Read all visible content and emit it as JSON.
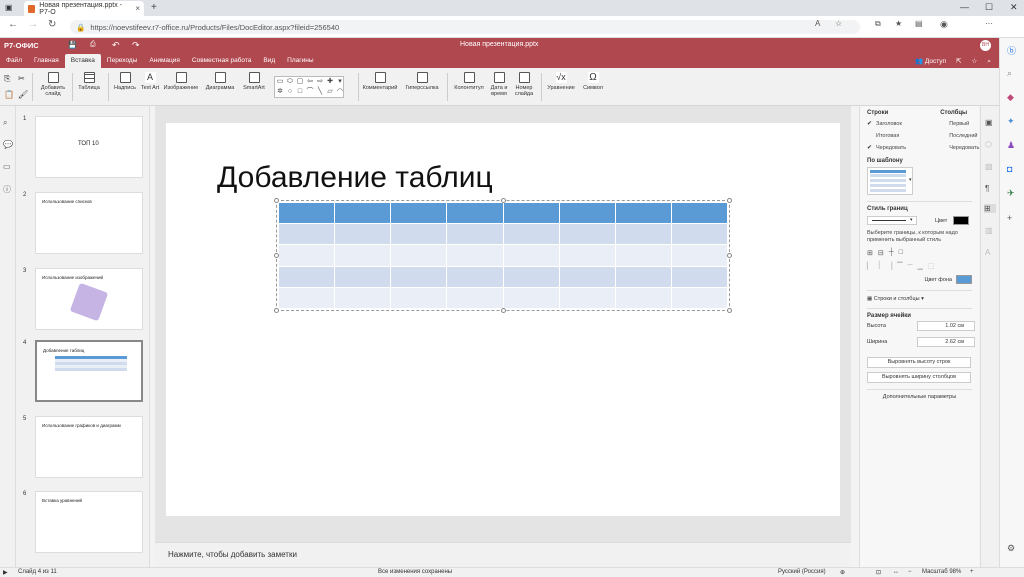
{
  "browser": {
    "tab_title": "Новая презентация.pptx - Р7-О",
    "url": "https://noevstifeev.r7-office.ru/Products/Files/DocEditor.aspx?fileid=256540"
  },
  "app": {
    "brand": "Р7-ОФИС",
    "doc_title": "Новая презентация.pptx",
    "access_label": "Доступ",
    "avatar": "ВН"
  },
  "menu": [
    "Файл",
    "Главная",
    "Вставка",
    "Переходы",
    "Анимация",
    "Совместная работа",
    "Вид",
    "Плагины"
  ],
  "toolbar": {
    "add_slide": "Добавить слайд",
    "table": "Таблица",
    "caption": "Надпись",
    "text_art": "Text Art",
    "image": "Изображение",
    "chart": "Диаграмма",
    "smartart": "SmartArt",
    "comment": "Комментарий",
    "hyperlink": "Гиперссылка",
    "header_footer": "Колонтитул",
    "datetime": "Дата и время",
    "slide_number": "Номер слайда",
    "equation": "Уравнение",
    "symbol": "Символ"
  },
  "thumbnails": [
    {
      "num": "1",
      "text": "ТОП 10"
    },
    {
      "num": "2",
      "text": "Использование списков"
    },
    {
      "num": "3",
      "text": "Использование изображений"
    },
    {
      "num": "4",
      "text": "Добавление таблиц"
    },
    {
      "num": "5",
      "text": "Использование графиков и диаграмм"
    },
    {
      "num": "6",
      "text": "Вставка уравнений"
    }
  ],
  "slide": {
    "title": "Добавление таблиц"
  },
  "notes_placeholder": "Нажмите, чтобы добавить заметки",
  "panel": {
    "rows_heading": "Строки",
    "cols_heading": "Столбцы",
    "rows_opts": [
      {
        "label": "Заголовок",
        "checked": true
      },
      {
        "label": "Итоговая",
        "checked": false
      },
      {
        "label": "Чередовать",
        "checked": true
      }
    ],
    "cols_opts": [
      {
        "label": "Первый",
        "checked": false
      },
      {
        "label": "Последний",
        "checked": false
      },
      {
        "label": "Чередовать",
        "checked": false
      }
    ],
    "template_heading": "По шаблону",
    "border_style_heading": "Стиль границ",
    "color_label": "Цвет",
    "border_hint": "Выберите границы, к которым надо применить выбранный стиль",
    "bg_color_label": "Цвет фона",
    "rows_cols": "Строки и столбцы",
    "cell_size_heading": "Размер ячейки",
    "height_label": "Высота",
    "height_value": "1.02 см",
    "width_label": "Ширина",
    "width_value": "2.62 см",
    "equal_rows": "Выровнять высоту строк",
    "equal_cols": "Выровнять ширину столбцов",
    "advanced": "Дополнительные параметры",
    "bg_color": "#5b9bd5"
  },
  "status": {
    "slide_of": "Слайд 4 из 11",
    "saved": "Все изменения сохранены",
    "language": "Русский (Россия)",
    "zoom": "Масштаб 98%"
  },
  "colors": {
    "accent": "#b0484f",
    "table_header": "#5b9bd5",
    "table_band1": "#d0dcee",
    "table_band2": "#e9eef7"
  }
}
